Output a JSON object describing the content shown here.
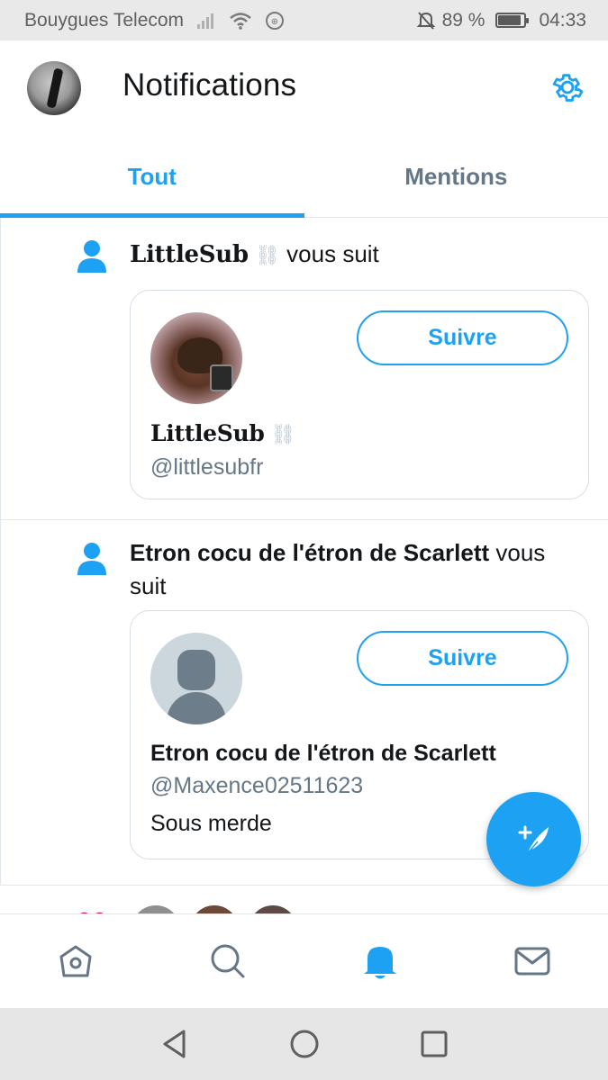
{
  "status_bar": {
    "carrier": "Bouygues Telecom",
    "battery_percent": "89 %",
    "battery_level": 0.89,
    "time": "04:33",
    "icons": [
      "signal-icon",
      "wifi-icon",
      "hotspot-icon",
      "mute-notifications-icon",
      "battery-icon"
    ]
  },
  "header": {
    "title": "Notifications",
    "settings_icon": "gear-icon",
    "accent_color": "#1da1f2"
  },
  "tabs": [
    {
      "label": "Tout",
      "active": true
    },
    {
      "label": "Mentions",
      "active": false
    }
  ],
  "notifications": [
    {
      "icon": "person-follow-icon",
      "actor": "LittleSub",
      "actor_decoration": "⛓",
      "action": "vous suit",
      "card": {
        "name": "LittleSub",
        "name_decoration": "⛓",
        "handle": "@littlesubfr",
        "follow_label": "Suivre"
      }
    },
    {
      "icon": "person-follow-icon",
      "actor": "Etron cocu de l'étron de Scarlett",
      "action": "vous suit",
      "card": {
        "name": "Etron cocu de l'étron de Scarlett",
        "handle": "@Maxence02511623",
        "bio": "Sous merde",
        "follow_label": "Suivre"
      }
    }
  ],
  "fab": {
    "icon": "compose-tweet-icon"
  },
  "bottom_nav": [
    {
      "icon": "home-icon",
      "active": false
    },
    {
      "icon": "search-icon",
      "active": false
    },
    {
      "icon": "bell-icon",
      "active": true
    },
    {
      "icon": "mail-icon",
      "active": false
    }
  ],
  "android_nav": [
    "back-icon",
    "home-circle-icon",
    "recents-icon"
  ]
}
